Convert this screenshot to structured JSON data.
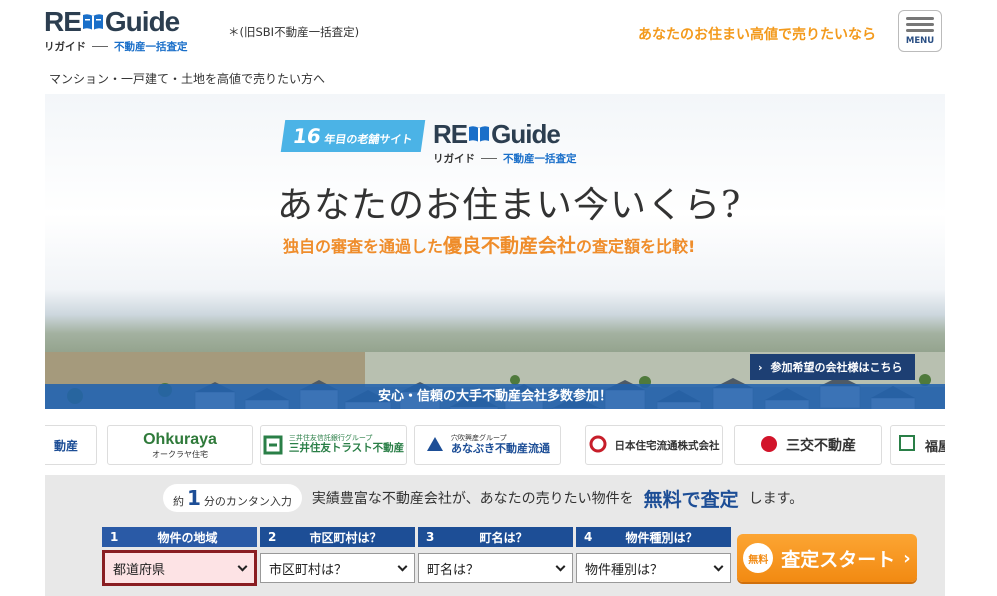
{
  "header": {
    "logo_main_left": "RE",
    "logo_main_right": "Guide",
    "logo_ruby": "リガイド",
    "logo_tag": "不動産一括査定",
    "former_name": "＊(旧SBI不動産一括査定)",
    "cta_text": "あなたのお住まい高値で売りたいなら",
    "menu_label": "MENU"
  },
  "breadcrumb": "マンション・一戸建て・土地を高値で売りたい方へ",
  "hero": {
    "badge_num": "16",
    "badge_text": "年目の老舗サイト",
    "headline": "あなたのお住まい今いくら?",
    "sub_pre": "独自の審査を通過した",
    "sub_big": "優良不動産会社",
    "sub_post": "の査定額を比較!",
    "member_link": "参加希望の会社様はこちら",
    "ribbon": "安心・信頼の大手不動産会社多数参加！"
  },
  "partners": [
    {
      "name": "動産"
    },
    {
      "name": "Ohkuraya",
      "sub": "オークラヤ住宅"
    },
    {
      "name": "三井住友トラスト不動産",
      "sub": "三井住友信託銀行グループ"
    },
    {
      "name": "あなぶき不動産流通",
      "sub": "穴吹興産グループ"
    },
    {
      "name": "日本住宅流通株式会社"
    },
    {
      "name": "三交不動産"
    },
    {
      "name": "福屋"
    }
  ],
  "form": {
    "pill_pre": "約",
    "pill_num": "1",
    "pill_post": "分のカンタン入力",
    "lead_text": "実績豊富な不動産会社が、あなたの売りたい物件を",
    "lead_free": "無料で査定",
    "lead_end": "します。",
    "steps": [
      {
        "num": "1",
        "title": "物件の地域",
        "value": "都道府県"
      },
      {
        "num": "2",
        "title": "市区町村は？",
        "value": "市区町村は？"
      },
      {
        "num": "3",
        "title": "町名は？",
        "value": "町名は？"
      },
      {
        "num": "4",
        "title": "物件種別は？",
        "value": "物件種別は？"
      }
    ],
    "start_free": "無料",
    "start_label": "査定スタート"
  },
  "colors": {
    "brand_navy": "#1d4e96",
    "accent_orange": "#f28a12",
    "cta_orange": "#f39a1c",
    "active_border": "#8a1d22"
  }
}
